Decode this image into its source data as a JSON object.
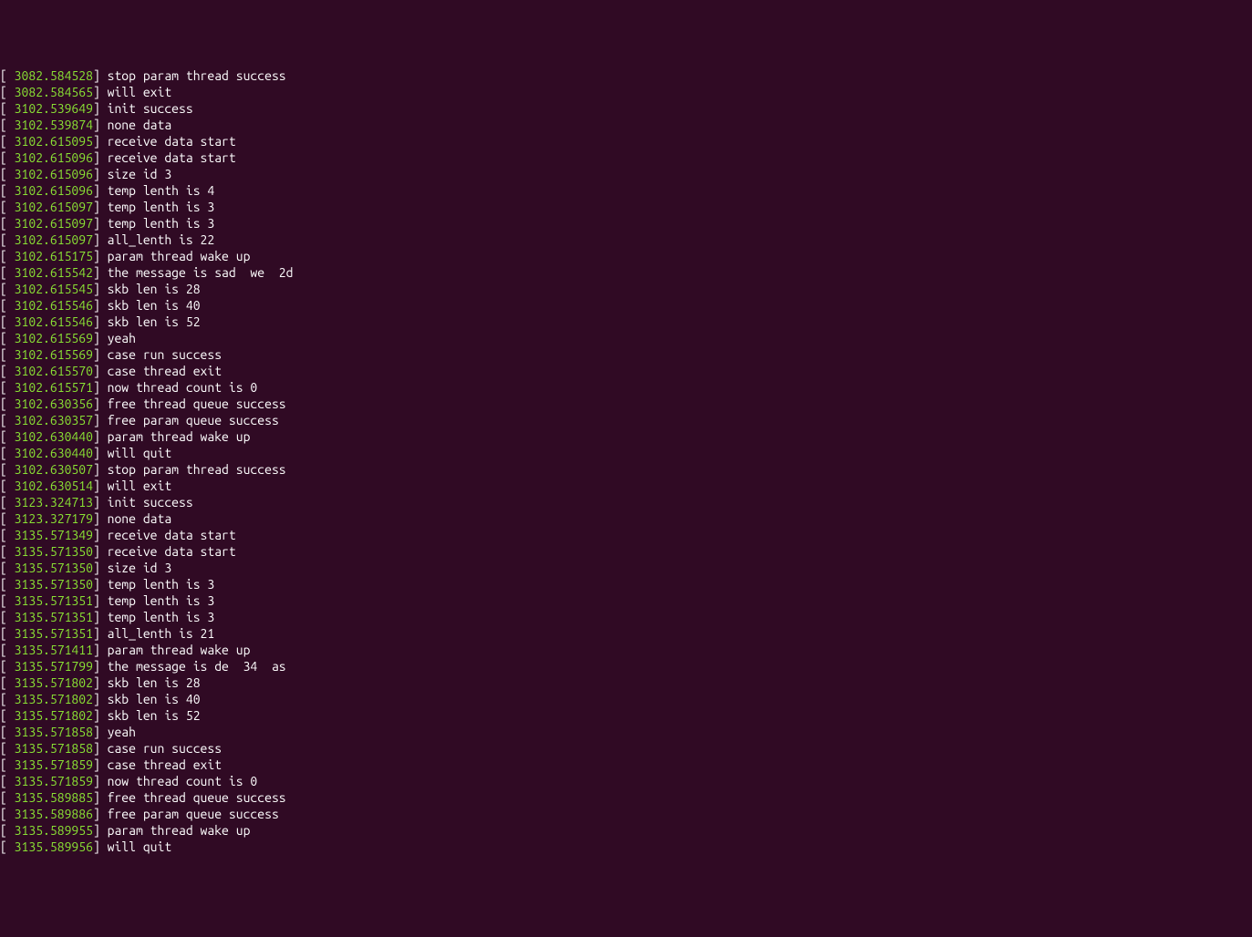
{
  "log_lines": [
    {
      "timestamp": " 3082.584528",
      "message": " stop param thread success"
    },
    {
      "timestamp": " 3082.584565",
      "message": " will exit"
    },
    {
      "timestamp": " 3102.539649",
      "message": " init success"
    },
    {
      "timestamp": " 3102.539874",
      "message": " none data"
    },
    {
      "timestamp": " 3102.615095",
      "message": " receive data start"
    },
    {
      "timestamp": " 3102.615096",
      "message": " receive data start"
    },
    {
      "timestamp": " 3102.615096",
      "message": " size id 3"
    },
    {
      "timestamp": " 3102.615096",
      "message": " temp lenth is 4"
    },
    {
      "timestamp": " 3102.615097",
      "message": " temp lenth is 3"
    },
    {
      "timestamp": " 3102.615097",
      "message": " temp lenth is 3"
    },
    {
      "timestamp": " 3102.615097",
      "message": " all_lenth is 22"
    },
    {
      "timestamp": " 3102.615175",
      "message": " param thread wake up"
    },
    {
      "timestamp": " 3102.615542",
      "message": " the message is sad  we  2d"
    },
    {
      "timestamp": " 3102.615545",
      "message": " skb len is 28"
    },
    {
      "timestamp": " 3102.615546",
      "message": " skb len is 40"
    },
    {
      "timestamp": " 3102.615546",
      "message": " skb len is 52"
    },
    {
      "timestamp": " 3102.615569",
      "message": " yeah"
    },
    {
      "timestamp": " 3102.615569",
      "message": " case run success"
    },
    {
      "timestamp": " 3102.615570",
      "message": " case thread exit"
    },
    {
      "timestamp": " 3102.615571",
      "message": " now thread count is 0"
    },
    {
      "timestamp": " 3102.630356",
      "message": " free thread queue success"
    },
    {
      "timestamp": " 3102.630357",
      "message": " free param queue success"
    },
    {
      "timestamp": " 3102.630440",
      "message": " param thread wake up"
    },
    {
      "timestamp": " 3102.630440",
      "message": " will quit"
    },
    {
      "timestamp": " 3102.630507",
      "message": " stop param thread success"
    },
    {
      "timestamp": " 3102.630514",
      "message": " will exit"
    },
    {
      "timestamp": " 3123.324713",
      "message": " init success"
    },
    {
      "timestamp": " 3123.327179",
      "message": " none data"
    },
    {
      "timestamp": " 3135.571349",
      "message": " receive data start"
    },
    {
      "timestamp": " 3135.571350",
      "message": " receive data start"
    },
    {
      "timestamp": " 3135.571350",
      "message": " size id 3"
    },
    {
      "timestamp": " 3135.571350",
      "message": " temp lenth is 3"
    },
    {
      "timestamp": " 3135.571351",
      "message": " temp lenth is 3"
    },
    {
      "timestamp": " 3135.571351",
      "message": " temp lenth is 3"
    },
    {
      "timestamp": " 3135.571351",
      "message": " all_lenth is 21"
    },
    {
      "timestamp": " 3135.571411",
      "message": " param thread wake up"
    },
    {
      "timestamp": " 3135.571799",
      "message": " the message is de  34  as"
    },
    {
      "timestamp": " 3135.571802",
      "message": " skb len is 28"
    },
    {
      "timestamp": " 3135.571802",
      "message": " skb len is 40"
    },
    {
      "timestamp": " 3135.571802",
      "message": " skb len is 52"
    },
    {
      "timestamp": " 3135.571858",
      "message": " yeah"
    },
    {
      "timestamp": " 3135.571858",
      "message": " case run success"
    },
    {
      "timestamp": " 3135.571859",
      "message": " case thread exit"
    },
    {
      "timestamp": " 3135.571859",
      "message": " now thread count is 0"
    },
    {
      "timestamp": " 3135.589885",
      "message": " free thread queue success"
    },
    {
      "timestamp": " 3135.589886",
      "message": " free param queue success"
    },
    {
      "timestamp": " 3135.589955",
      "message": " param thread wake up"
    },
    {
      "timestamp": " 3135.589956",
      "message": " will quit"
    }
  ]
}
